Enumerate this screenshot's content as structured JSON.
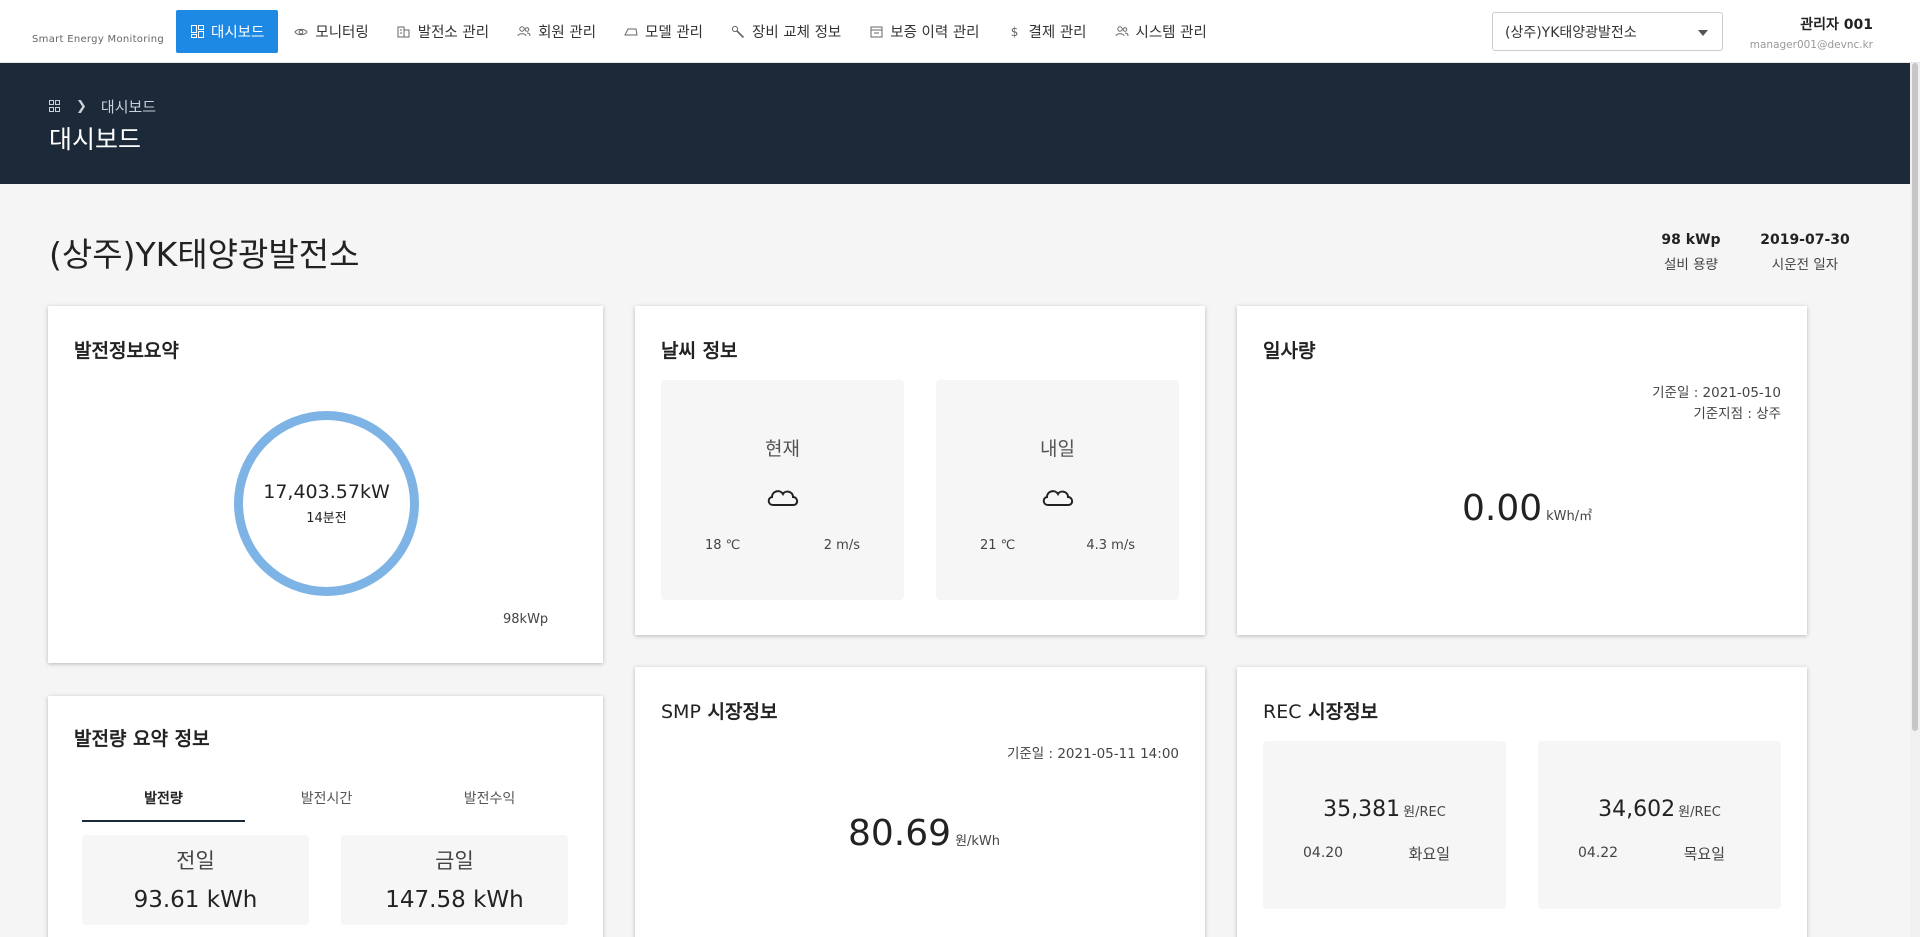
{
  "app": {
    "logo_subtitle": "Smart Energy Monitoring"
  },
  "nav": {
    "items": [
      {
        "label": "대시보드",
        "icon": "dashboard-icon",
        "active": true
      },
      {
        "label": "모니터링",
        "icon": "eye-icon"
      },
      {
        "label": "발전소 관리",
        "icon": "building-icon"
      },
      {
        "label": "회원 관리",
        "icon": "users-icon"
      },
      {
        "label": "모델 관리",
        "icon": "model-icon"
      },
      {
        "label": "장비 교체 정보",
        "icon": "wrench-icon"
      },
      {
        "label": "보증 이력 관리",
        "icon": "calendar-icon"
      },
      {
        "label": "결제 관리",
        "icon": "dollar-icon"
      },
      {
        "label": "시스템 관리",
        "icon": "users-icon"
      }
    ]
  },
  "site_select": {
    "value": "(상주)YK태양광발전소"
  },
  "user": {
    "name": "관리자 001",
    "email": "manager001@devnc.kr"
  },
  "breadcrumb": {
    "current": "대시보드"
  },
  "page_title": "대시보드",
  "plant": {
    "name": "(상주)YK태양광발전소",
    "capacity_value": "98 kWp",
    "capacity_label": "설비 용량",
    "start_date_value": "2019-07-30",
    "start_date_label": "시운전 일자"
  },
  "summary_card": {
    "title": "발전정보요약",
    "power": "17,403.57kW",
    "minutes": "14분전",
    "capacity": "98kWp"
  },
  "weather_card": {
    "title": "날씨 정보",
    "today": {
      "label": "현재",
      "icon": "cloud-icon",
      "temp": "18 ℃",
      "wind": "2 m/s"
    },
    "tomorrow": {
      "label": "내일",
      "icon": "cloud-icon",
      "temp": "21 ℃",
      "wind": "4.3 m/s"
    }
  },
  "insolation_card": {
    "title": "일사량",
    "ref_date": "기준일 : 2021-05-10",
    "ref_place": "기준지점 : 상주",
    "value": "0.00",
    "unit": "kWh/㎡"
  },
  "generation_card": {
    "title": "발전량 요약 정보",
    "tabs": [
      "발전량",
      "발전시간",
      "발전수익"
    ],
    "active_tab": "발전량",
    "prev_label": "전일",
    "prev_value": "93.61 kWh",
    "today_label": "금일",
    "today_value": "147.58 kWh"
  },
  "smp_card": {
    "title_prefix": "SMP",
    "title_suffix": "시장정보",
    "ref_date": "기준일 : 2021-05-11 14:00",
    "value": "80.69",
    "unit": "원/kWh"
  },
  "rec_card": {
    "title_prefix": "REC",
    "title_suffix": "시장정보",
    "items": [
      {
        "price": "35,381",
        "unit": "원/REC",
        "date": "04.20",
        "day": "화요일"
      },
      {
        "price": "34,602",
        "unit": "원/REC",
        "date": "04.22",
        "day": "목요일"
      }
    ]
  },
  "colors": {
    "primary": "#1e88e5",
    "banner": "#1c2938",
    "donut": "#7eb3e6"
  }
}
